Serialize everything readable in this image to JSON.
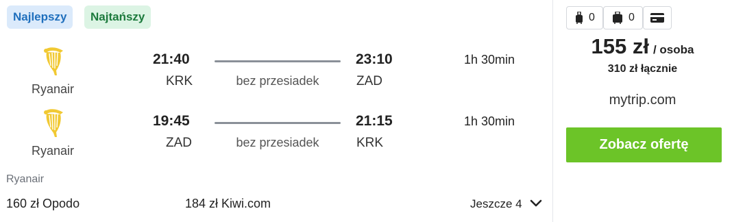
{
  "badges": {
    "best": "Najlepszy",
    "cheapest": "Najtańszy"
  },
  "legs": [
    {
      "airline": "Ryanair",
      "dep_time": "21:40",
      "arr_time": "23:10",
      "dep_code": "KRK",
      "arr_code": "ZAD",
      "stops": "bez przesiadek",
      "duration": "1h 30min"
    },
    {
      "airline": "Ryanair",
      "dep_time": "19:45",
      "arr_time": "21:15",
      "dep_code": "ZAD",
      "arr_code": "KRK",
      "stops": "bez przesiadek",
      "duration": "1h 30min"
    }
  ],
  "operated_by": "Ryanair",
  "alternatives": [
    "160 zł Opodo",
    "184 zł Kiwi.com"
  ],
  "more_label": "Jeszcze 4",
  "baggage": {
    "cabin_count": "0",
    "checked_count": "0"
  },
  "price": {
    "amount": "155 zł",
    "per": "/ osoba",
    "total": "310 zł łącznie"
  },
  "provider": "mytrip.com",
  "cta_label": "Zobacz ofertę",
  "colors": {
    "accent_green": "#6cc428",
    "best_badge_bg": "#dbeafb",
    "cheap_badge_bg": "#dcf4e4",
    "logo_yellow": "#f1c933"
  },
  "icons": [
    "ryanair-harp-icon",
    "cabin-bag-icon",
    "checked-bag-icon",
    "card-icon",
    "chevron-down-icon"
  ]
}
